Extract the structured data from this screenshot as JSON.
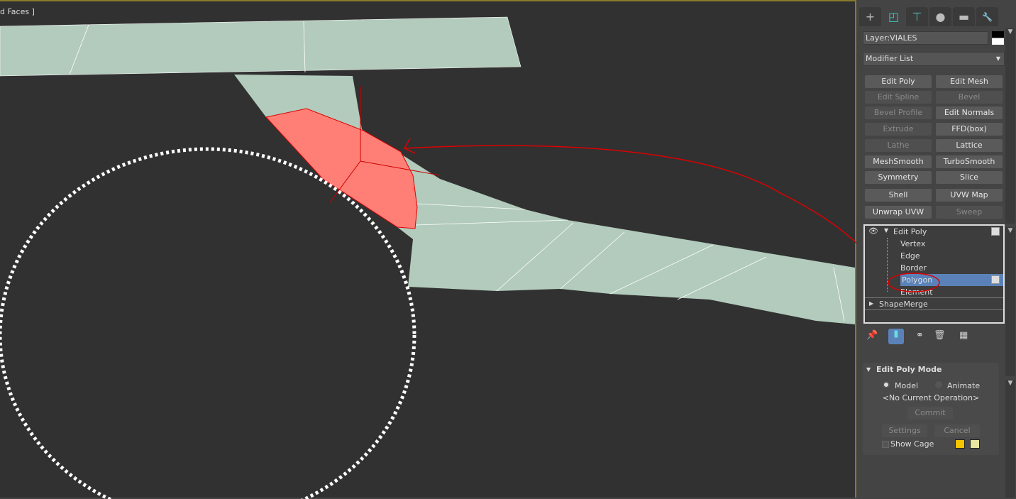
{
  "viewport": {
    "label": "d Faces ]"
  },
  "panel": {
    "tabs": [
      {
        "icon": "create-icon",
        "glyph": "+"
      },
      {
        "icon": "modify-icon",
        "glyph": "◰"
      },
      {
        "icon": "hierarchy-icon",
        "glyph": "⊤"
      },
      {
        "icon": "motion-icon",
        "glyph": "●"
      },
      {
        "icon": "display-icon",
        "glyph": "▬"
      },
      {
        "icon": "utilities-icon",
        "glyph": "🔧"
      }
    ],
    "layer": "Layer:VIALES",
    "modifier_list": "Modifier List",
    "buttons": [
      {
        "label": "Edit Poly",
        "enabled": true
      },
      {
        "label": "Edit Mesh",
        "enabled": true
      },
      {
        "label": "Edit Spline",
        "enabled": false
      },
      {
        "label": "Bevel",
        "enabled": false
      },
      {
        "label": "Bevel Profile",
        "enabled": false
      },
      {
        "label": "Edit Normals",
        "enabled": true
      },
      {
        "label": "Extrude",
        "enabled": false
      },
      {
        "label": "FFD(box)",
        "enabled": true
      },
      {
        "label": "Lathe",
        "enabled": false
      },
      {
        "label": "Lattice",
        "enabled": true
      },
      {
        "label": "MeshSmooth",
        "enabled": true
      },
      {
        "label": "TurboSmooth",
        "enabled": true
      },
      {
        "label": "Symmetry",
        "enabled": true
      },
      {
        "label": "Slice",
        "enabled": true
      },
      {
        "label": "Shell",
        "enabled": true
      },
      {
        "label": "UVW Map",
        "enabled": true
      },
      {
        "label": "Unwrap UVW",
        "enabled": true
      },
      {
        "label": "Sweep",
        "enabled": false
      }
    ],
    "stack": {
      "modifier": "Edit Poly",
      "subobjects": [
        "Vertex",
        "Edge",
        "Border",
        "Polygon",
        "Element"
      ],
      "selected": "Polygon",
      "other": "ShapeMerge"
    },
    "rollout": {
      "title": "Edit Poly Mode",
      "model": "Model",
      "animate": "Animate",
      "selected_mode": "Model",
      "operation": "<No Current Operation>",
      "commit": "Commit",
      "settings": "Settings",
      "cancel": "Cancel",
      "show_cage": "Show Cage",
      "show_cage_checked": false,
      "cage_colors": [
        "#f5c400",
        "#e8e6a0"
      ]
    }
  },
  "colors": {
    "selection": "#ff7f76",
    "mesh": "#b2cbbc",
    "annotation": "#dd0000",
    "highlight": "#5a82b8"
  }
}
